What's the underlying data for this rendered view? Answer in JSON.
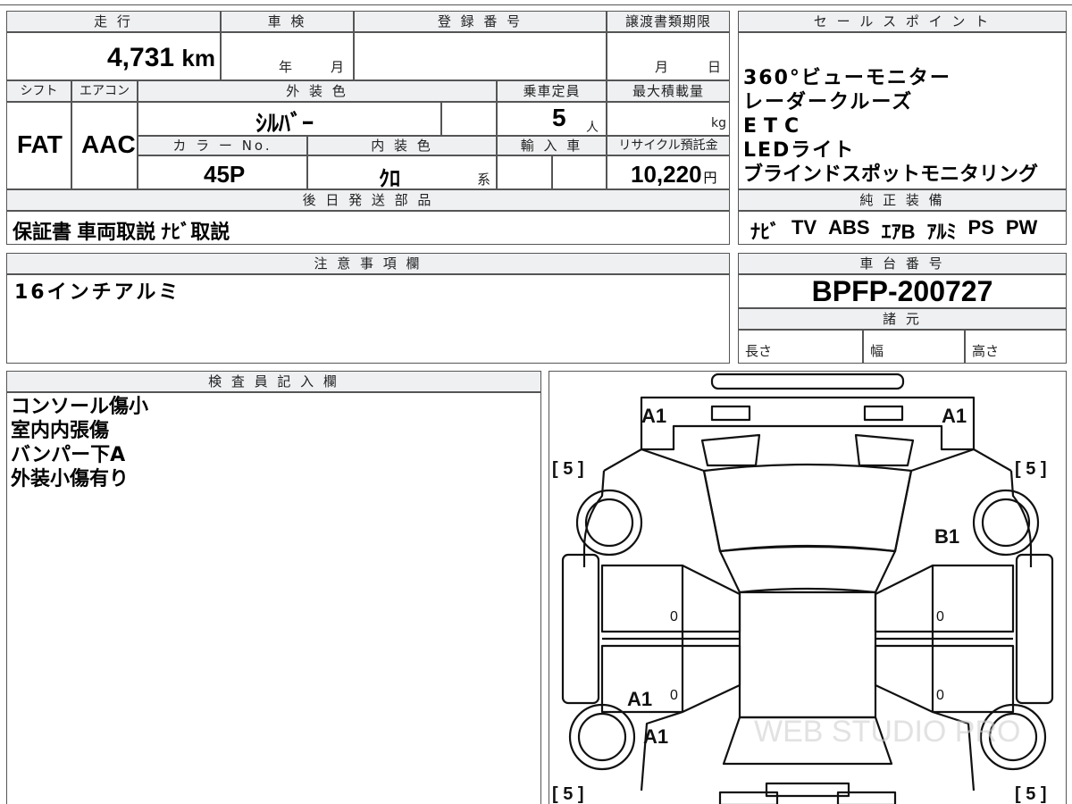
{
  "vehicle": {
    "mileage_label": "走 行",
    "mileage_value": "4,731",
    "mileage_unit": "km",
    "inspection_label": "車 検",
    "inspection_year": "年",
    "inspection_month": "月",
    "registration_label": "登 録 番 号",
    "transfer_label": "譲渡書類期限",
    "transfer_month": "月",
    "transfer_day": "日",
    "shift_label": "シフト",
    "shift_value": "FAT",
    "aircon_label": "エアコン",
    "aircon_value": "AAC",
    "exterior_label": "外 装 色",
    "exterior_value": "ｼﾙﾊﾞｰ",
    "capacity_label": "乗車定員",
    "capacity_value": "5",
    "capacity_unit": "人",
    "maxload_label": "最大積載量",
    "maxload_unit": "kg",
    "color_no_label": "カ ラ ー No.",
    "color_no_value": "45P",
    "interior_label": "内 装 色",
    "interior_value": "ｸﾛ",
    "interior_suffix": "系",
    "import_label": "輸 入 車",
    "recycle_label": "リサイクル預託金",
    "recycle_value": "10,220",
    "recycle_unit": "円"
  },
  "sales_points": {
    "title": "セ ー ル ス ポ イ ン ト",
    "items": [
      "360°ビューモニター",
      "レーダークルーズ",
      "ETC",
      "LEDライト",
      "ブラインドスポットモニタリング"
    ]
  },
  "later_parts": {
    "title": "後 日 発 送 部 品",
    "value": "保証書 車両取説 ﾅﾋﾞ取説"
  },
  "genuine_equipment": {
    "title": "純 正 装 備",
    "items": [
      "ﾅﾋﾞ",
      "TV",
      "ABS",
      "ｴｱB",
      "ｱﾙﾐ",
      "PS",
      "PW"
    ]
  },
  "caution": {
    "title": "注 意 事 項 欄",
    "value": "16インチアルミ"
  },
  "chassis": {
    "title": "車 台 番 号",
    "value": "BPFP-200727",
    "spec_title": "諸 元",
    "length_label": "長さ",
    "width_label": "幅",
    "height_label": "高さ"
  },
  "inspector": {
    "title": "検 査 員 記 入 欄",
    "lines": [
      "コンソール傷小",
      "室内内張傷",
      "バンパー下A",
      "外装小傷有り"
    ]
  },
  "diagram": {
    "marks": {
      "front_left": "A1",
      "front_right": "A1",
      "right_door": "B1",
      "rear_left_1": "A1",
      "rear_left_2": "A1",
      "tire_fl": "[ 5 ]",
      "tire_fr": "[ 5 ]",
      "tire_rl": "[ 5 ]",
      "tire_rr": "[ 5 ]",
      "door_zero_1": "0",
      "door_zero_2": "0",
      "door_zero_3": "0",
      "door_zero_4": "0"
    },
    "watermark": "WEB STUDIO PRO"
  }
}
